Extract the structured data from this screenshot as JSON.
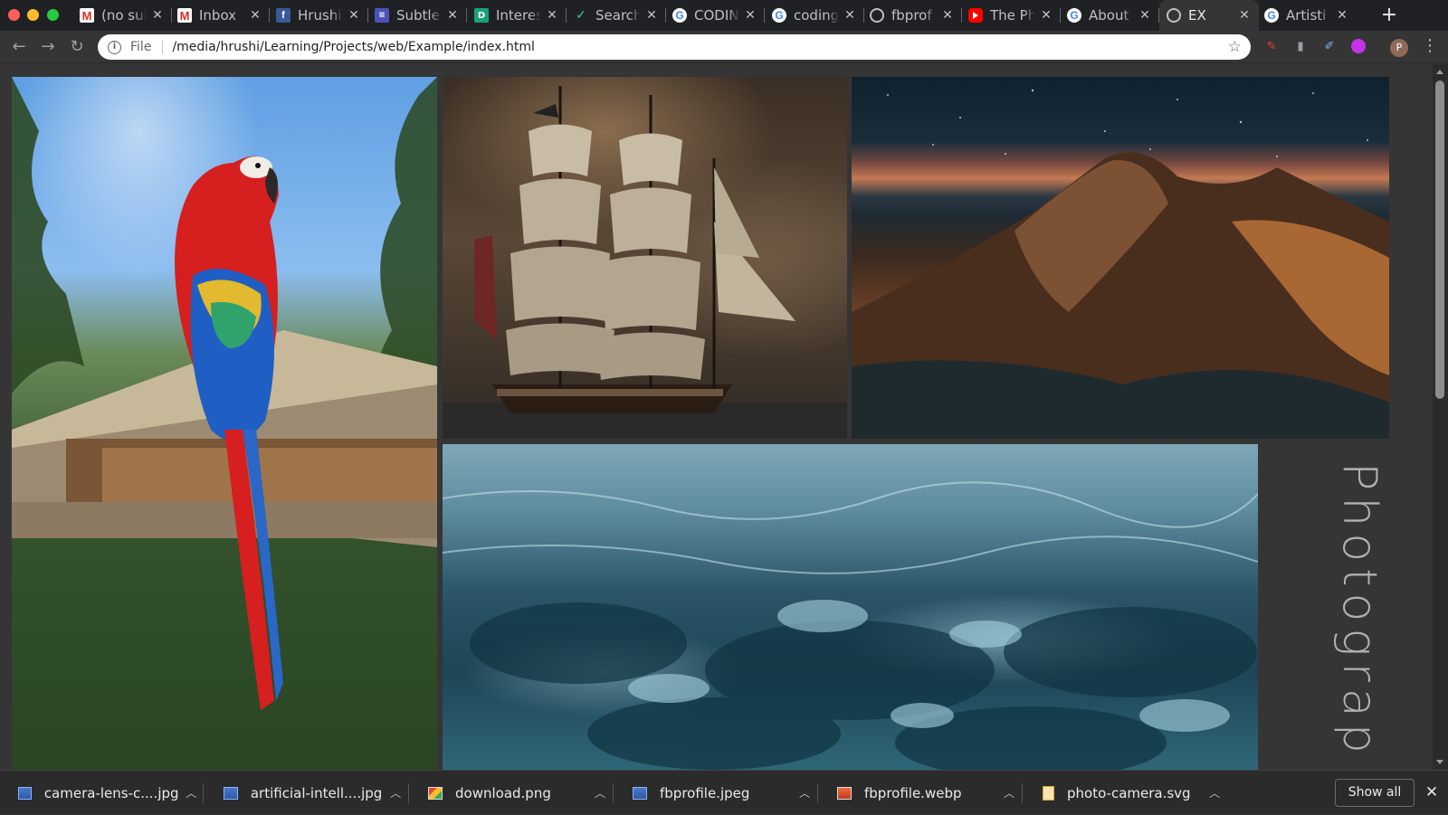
{
  "tabs": [
    {
      "title": "(no subject)",
      "favicon": "gmail-icon"
    },
    {
      "title": "Inbox",
      "favicon": "gmail-icon"
    },
    {
      "title": "Hrushi",
      "favicon": "facebook-icon"
    },
    {
      "title": "Subtle",
      "favicon": "subtle-icon"
    },
    {
      "title": "Interes",
      "favicon": "dd-icon"
    },
    {
      "title": "Search",
      "favicon": "search-icon"
    },
    {
      "title": "CODIN",
      "favicon": "google-icon"
    },
    {
      "title": "coding",
      "favicon": "google-icon"
    },
    {
      "title": "fbprof",
      "favicon": "globe-icon"
    },
    {
      "title": "The Ph",
      "favicon": "youtube-icon"
    },
    {
      "title": "About",
      "favicon": "google-icon"
    },
    {
      "title": "EX",
      "favicon": "globe-icon",
      "active": true
    },
    {
      "title": "Artisti",
      "favicon": "google-icon"
    }
  ],
  "toolbar": {
    "scheme": "File",
    "url": "/media/hrushi/Learning/Projects/web/Example/index.html",
    "profile_initial": "P"
  },
  "gallery": {
    "photos": [
      "parrot",
      "sailing-ship",
      "mountain-night",
      "ocean-water"
    ],
    "side_title": "Photograp"
  },
  "downloads": [
    {
      "name": "camera-lens-c....jpg",
      "type": "jpg"
    },
    {
      "name": "artificial-intell....jpg",
      "type": "jpg"
    },
    {
      "name": "download.png",
      "type": "png"
    },
    {
      "name": "fbprofile.jpeg",
      "type": "jpg"
    },
    {
      "name": "fbprofile.webp",
      "type": "webp"
    },
    {
      "name": "photo-camera.svg",
      "type": "svg"
    }
  ],
  "shelf": {
    "show_all_label": "Show all"
  },
  "colors": {
    "background": "#353535",
    "tabstrip": "#202124",
    "shelf": "#2b2b2b"
  }
}
